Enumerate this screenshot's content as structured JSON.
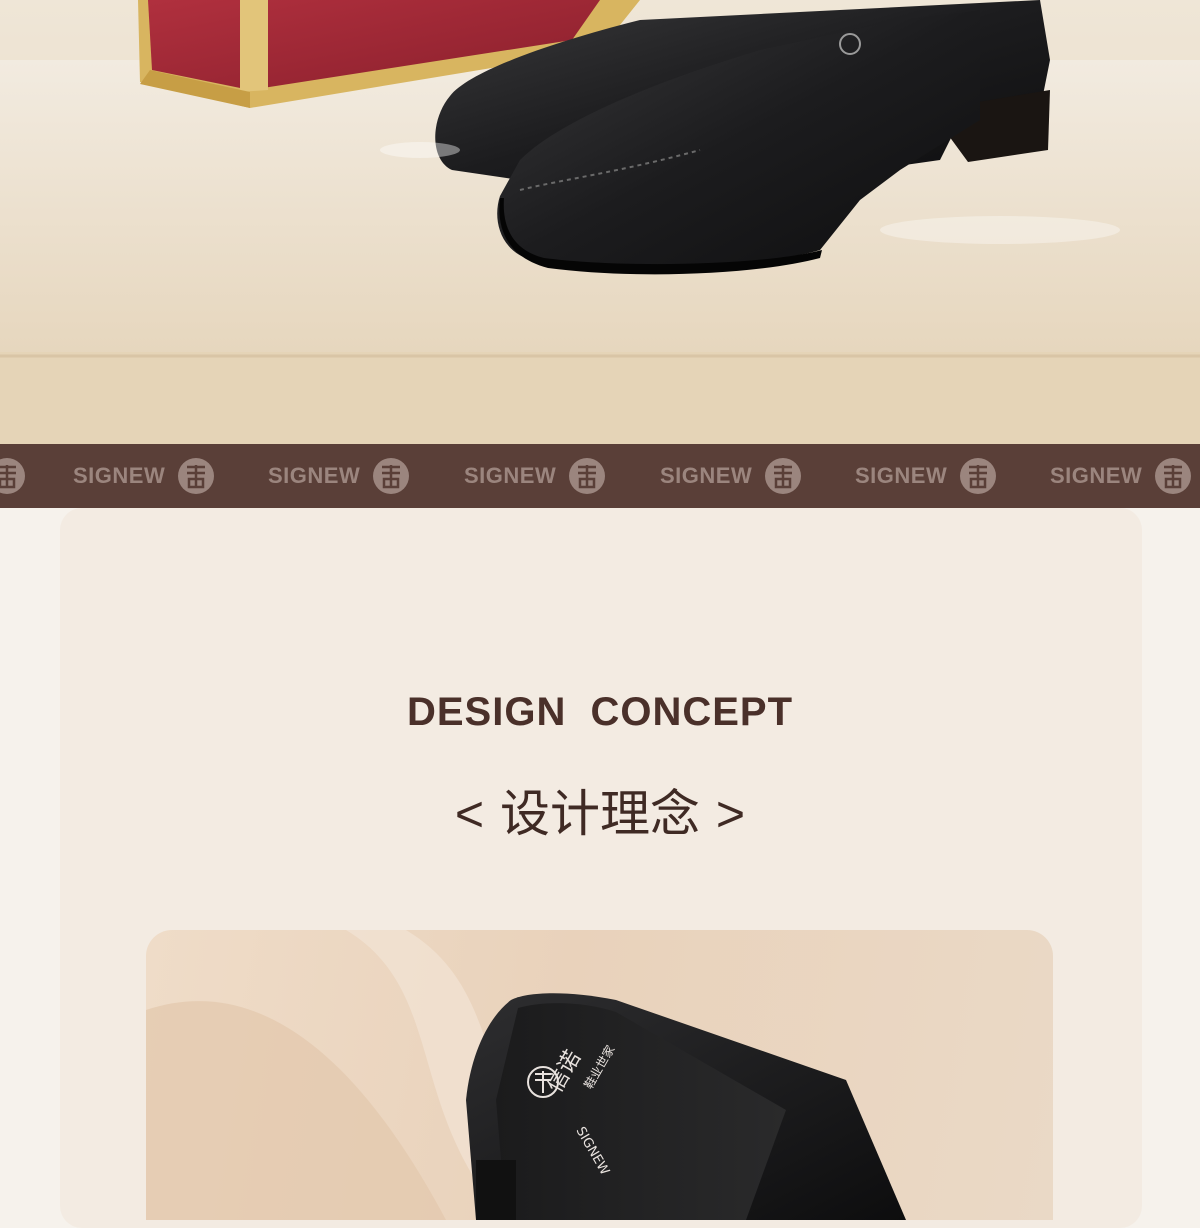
{
  "hero": {
    "image_label": "black leather shoes in front of red gift box"
  },
  "brand_strip": {
    "wordmark": "SIGNEW",
    "seal_icon": "signew-seal-icon",
    "colors": {
      "background": "#5a3f38",
      "text": "#9b857e"
    }
  },
  "concept": {
    "title": "DESIGN CONCEPT",
    "subtitle_open": "<",
    "subtitle": "设计理念",
    "subtitle_close": ">",
    "colors": {
      "card": "#f3ebe2",
      "title": "#4a302a"
    }
  },
  "product_photo": {
    "insole_logo_cn": "信诺",
    "insole_tagline": "鞋业世家",
    "insole_brand": "SIGNEW"
  }
}
